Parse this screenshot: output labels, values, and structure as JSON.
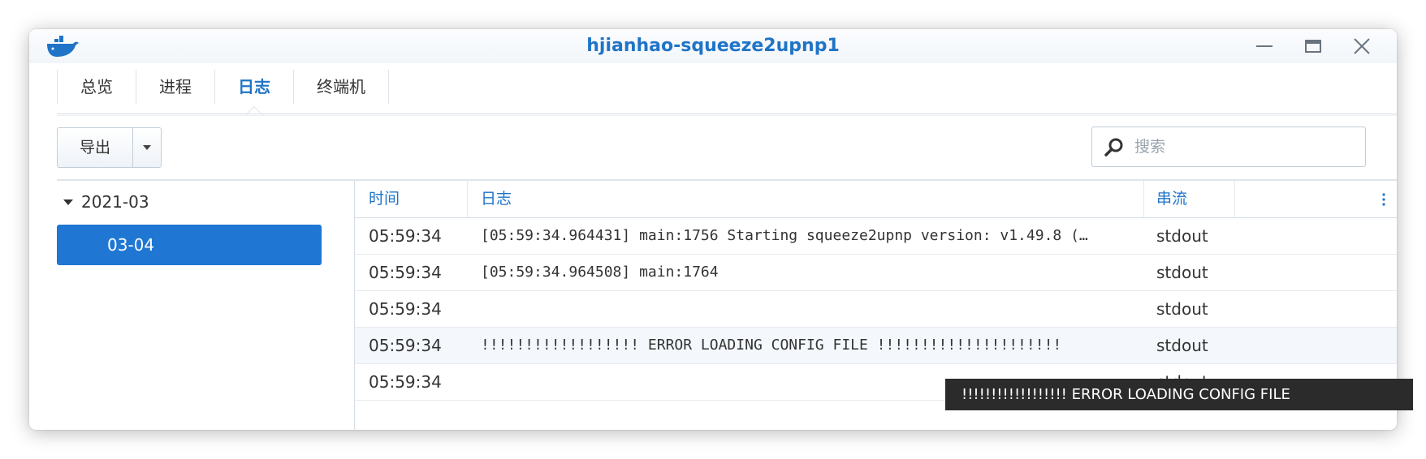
{
  "window": {
    "title": "hjianhao-squeeze2upnp1",
    "logo_icon": "docker-whale-icon",
    "controls": [
      "minimize-icon",
      "maximize-icon",
      "close-icon"
    ]
  },
  "tabs": [
    {
      "label": "总览",
      "active": false
    },
    {
      "label": "进程",
      "active": false
    },
    {
      "label": "日志",
      "active": true
    },
    {
      "label": "终端机",
      "active": false
    }
  ],
  "toolbar": {
    "export_label": "导出",
    "search_placeholder": "搜索"
  },
  "tree": {
    "group": "2021-03",
    "items": [
      {
        "label": "03-04",
        "selected": true
      }
    ]
  },
  "log_table": {
    "columns": [
      "时间",
      "日志",
      "串流"
    ],
    "rows": [
      {
        "time": "05:59:34",
        "log": "[05:59:34.964431] main:1756 Starting squeeze2upnp version: v1.49.8 (…",
        "stream": "stdout"
      },
      {
        "time": "05:59:34",
        "log": "[05:59:34.964508] main:1764",
        "stream": "stdout"
      },
      {
        "time": "05:59:34",
        "log": "",
        "stream": "stdout"
      },
      {
        "time": "05:59:34",
        "log": "!!!!!!!!!!!!!!!!!! ERROR LOADING CONFIG FILE !!!!!!!!!!!!!!!!!!!!!",
        "stream": "stdout"
      },
      {
        "time": "05:59:34",
        "log": "",
        "stream": "stdout"
      }
    ]
  },
  "tooltip": "!!!!!!!!!!!!!!!!!! ERROR LOADING CONFIG FILE",
  "colors": {
    "accent": "#1f74c7",
    "selected_bg": "#1f77d3",
    "tooltip_bg": "#2b2b2b"
  }
}
